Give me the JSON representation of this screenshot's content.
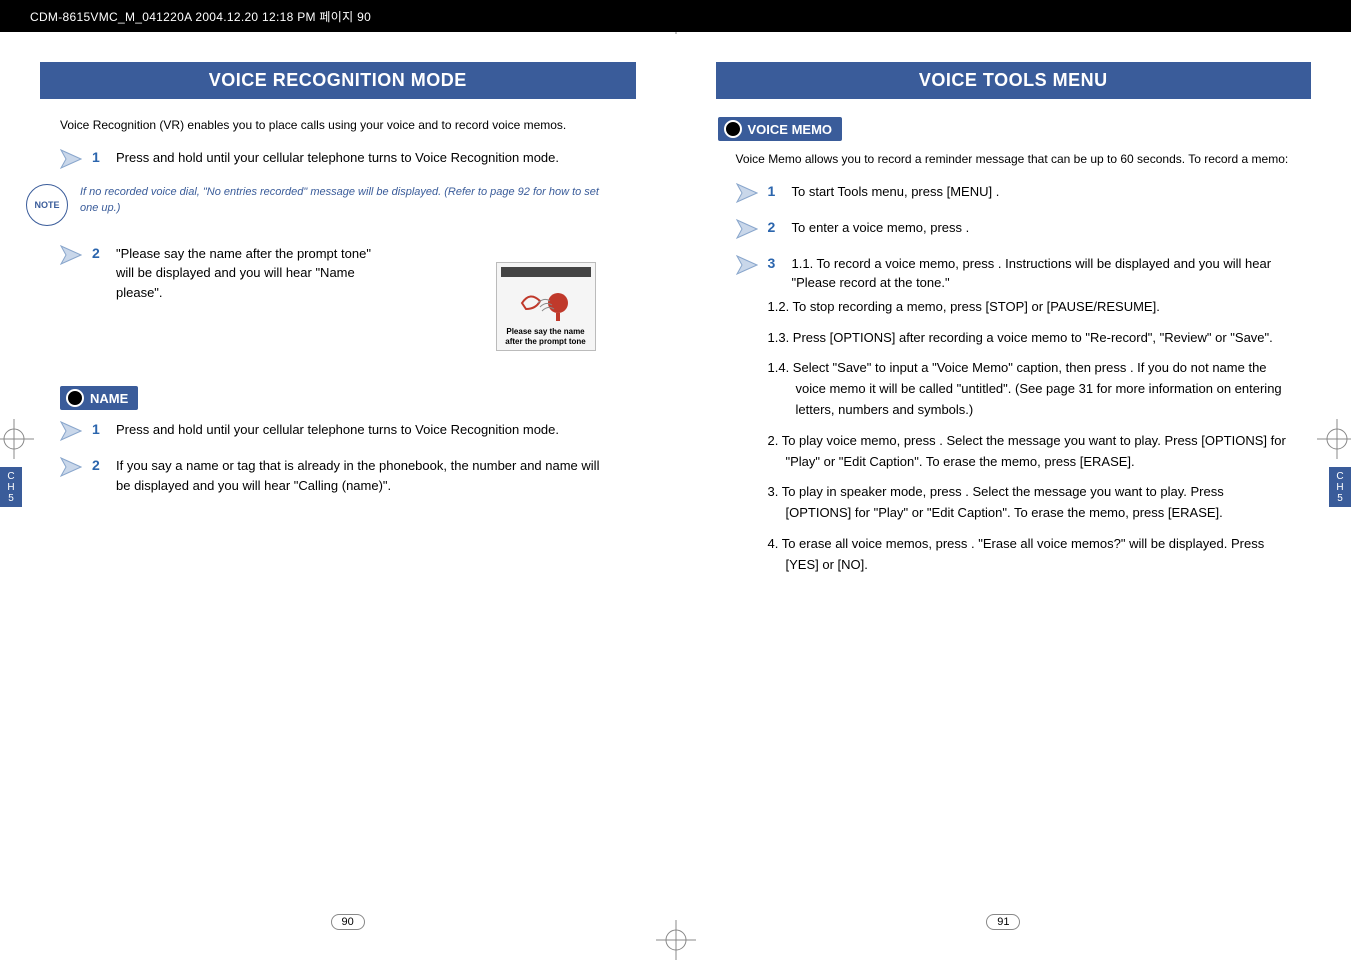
{
  "header": "CDM-8615VMC_M_041220A  2004.12.20 12:18 PM  페이지 90",
  "left": {
    "title": "VOICE RECOGNITION MODE",
    "intro": "Voice Recognition (VR) enables you to place calls using your voice and to record voice memos.",
    "step1": "Press and hold        until your cellular telephone turns to Voice Recognition mode.",
    "note": "If no recorded voice dial, \"No entries recorded\" message will be displayed. (Refer to page 92 for how to set one up.)",
    "note_label": "NOTE",
    "step2": "\"Please say the name after the prompt tone\" will be displayed and you will hear \"Name please\".",
    "phone_caption": "Please say the name after the prompt tone",
    "name_heading": "NAME",
    "name_step1": "Press and hold        until your cellular telephone turns to Voice Recognition mode.",
    "name_step2": "If you say a name or tag that is already in the phonebook, the number and name will be displayed and you will hear \"Calling (name)\".",
    "page_no": "90",
    "ch_tab_top": "C\nH",
    "ch_tab_num": "5"
  },
  "right": {
    "title": "VOICE TOOLS MENU",
    "memo_heading": "VOICE MEMO",
    "memo_intro": "Voice Memo allows you to record a reminder message that can be up to 60 seconds.  To record a memo:",
    "step1": "To start Tools menu, press      [MENU]       .",
    "step2": "To enter a voice memo, press       .",
    "step3_1": "1.1. To record a voice memo, press       . Instructions will be displayed and you will hear \"Please record at the tone.\"",
    "step3_2": "1.2. To stop recording a memo, press      [STOP] or      [PAUSE/RESUME].",
    "step3_3": "1.3. Press      [OPTIONS] after recording a voice memo to \"Re-record\", \"Review\" or \"Save\".",
    "step3_4": "1.4. Select \"Save\" to input a \"Voice Memo\" caption, then press      .  If you do not name the voice memo it will be called \"untitled\". (See page 31 for more information on entering letters, numbers and symbols.)",
    "item2": "2. To play voice memo, press       . Select the message you want to play. Press     [OPTIONS] for \"Play\" or \"Edit Caption\". To erase the memo, press      [ERASE].",
    "item3": "3. To play in speaker mode, press       . Select the message you want to play. Press      [OPTIONS] for \"Play\" or \"Edit Caption\". To erase the memo, press      [ERASE].",
    "item4": "4. To erase all voice memos, press       . \"Erase all voice memos?\" will be displayed. Press      [YES] or      [NO].",
    "page_no": "91",
    "ch_tab_top": "C\nH",
    "ch_tab_num": "5"
  }
}
